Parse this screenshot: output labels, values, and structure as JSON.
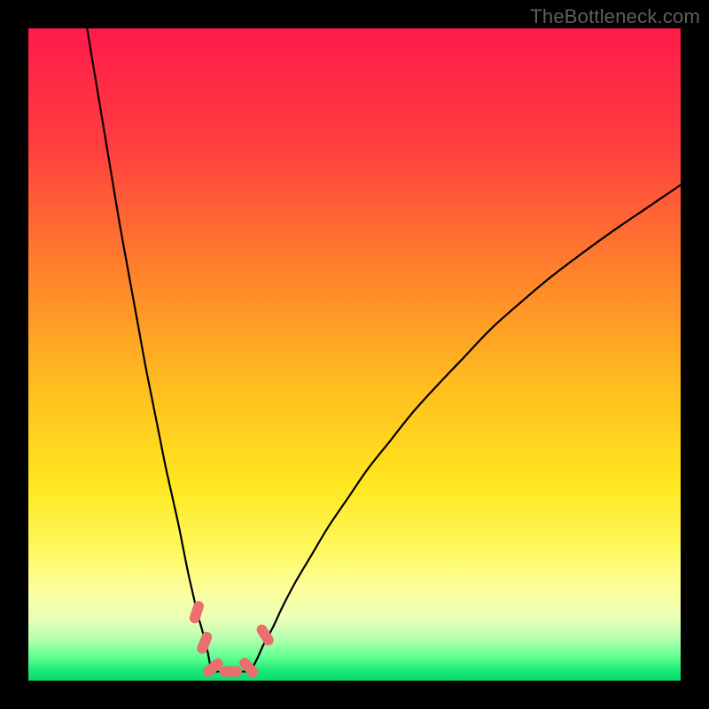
{
  "watermark": "TheBottleneck.com",
  "chart_data": {
    "type": "line",
    "title": "",
    "xlabel": "",
    "ylabel": "",
    "xlim": [
      0,
      100
    ],
    "ylim": [
      0,
      100
    ],
    "gradient_stops": [
      {
        "offset": 0.0,
        "color": "#ff1b4b"
      },
      {
        "offset": 0.18,
        "color": "#ff3e3f"
      },
      {
        "offset": 0.38,
        "color": "#ff842b"
      },
      {
        "offset": 0.55,
        "color": "#ffbe1f"
      },
      {
        "offset": 0.7,
        "color": "#ffe71f"
      },
      {
        "offset": 0.8,
        "color": "#fff85e"
      },
      {
        "offset": 0.86,
        "color": "#fcff9c"
      },
      {
        "offset": 0.905,
        "color": "#e9ffb8"
      },
      {
        "offset": 0.935,
        "color": "#b8ffb0"
      },
      {
        "offset": 0.965,
        "color": "#5cff8f"
      },
      {
        "offset": 0.985,
        "color": "#18e877"
      },
      {
        "offset": 1.0,
        "color": "#0fd96e"
      }
    ],
    "series": [
      {
        "name": "left-curve",
        "x": [
          9.0,
          10.0,
          11.0,
          12.0,
          13.0,
          14.0,
          15.0,
          16.0,
          17.0,
          18.0,
          19.0,
          20.0,
          21.0,
          22.0,
          23.0,
          23.8,
          24.5,
          25.3,
          26.0,
          26.8,
          27.4,
          27.8,
          28.0
        ],
        "y": [
          100.0,
          94.0,
          88.0,
          82.0,
          76.0,
          70.0,
          64.5,
          59.0,
          53.5,
          48.0,
          43.0,
          38.0,
          33.0,
          28.5,
          24.0,
          20.0,
          16.5,
          13.0,
          10.0,
          7.2,
          4.8,
          2.8,
          1.4
        ]
      },
      {
        "name": "right-curve",
        "x": [
          34.0,
          35.0,
          36.0,
          37.5,
          39.0,
          41.0,
          43.5,
          46.0,
          49.0,
          52.0,
          55.5,
          59.0,
          63.0,
          67.0,
          71.0,
          75.5,
          80.0,
          85.0,
          90.0,
          95.0,
          100.0
        ],
        "y": [
          1.4,
          3.2,
          5.4,
          8.2,
          11.4,
          15.2,
          19.4,
          23.6,
          28.0,
          32.4,
          36.8,
          41.2,
          45.6,
          49.8,
          54.0,
          58.0,
          61.8,
          65.6,
          69.2,
          72.6,
          76.0
        ]
      }
    ],
    "flat_segment": {
      "x_start": 28.0,
      "x_end": 34.0,
      "y": 1.4
    },
    "markers": [
      {
        "x": 25.8,
        "y": 10.5,
        "angle": -72
      },
      {
        "x": 27.0,
        "y": 5.8,
        "angle": -68
      },
      {
        "x": 28.3,
        "y": 2.0,
        "angle": -40
      },
      {
        "x": 31.0,
        "y": 1.4,
        "angle": 0
      },
      {
        "x": 33.8,
        "y": 2.0,
        "angle": 48
      },
      {
        "x": 36.3,
        "y": 7.0,
        "angle": 58
      }
    ],
    "marker_style": {
      "color": "#e9706e",
      "length_frac": 0.035,
      "width_frac": 0.016
    }
  }
}
